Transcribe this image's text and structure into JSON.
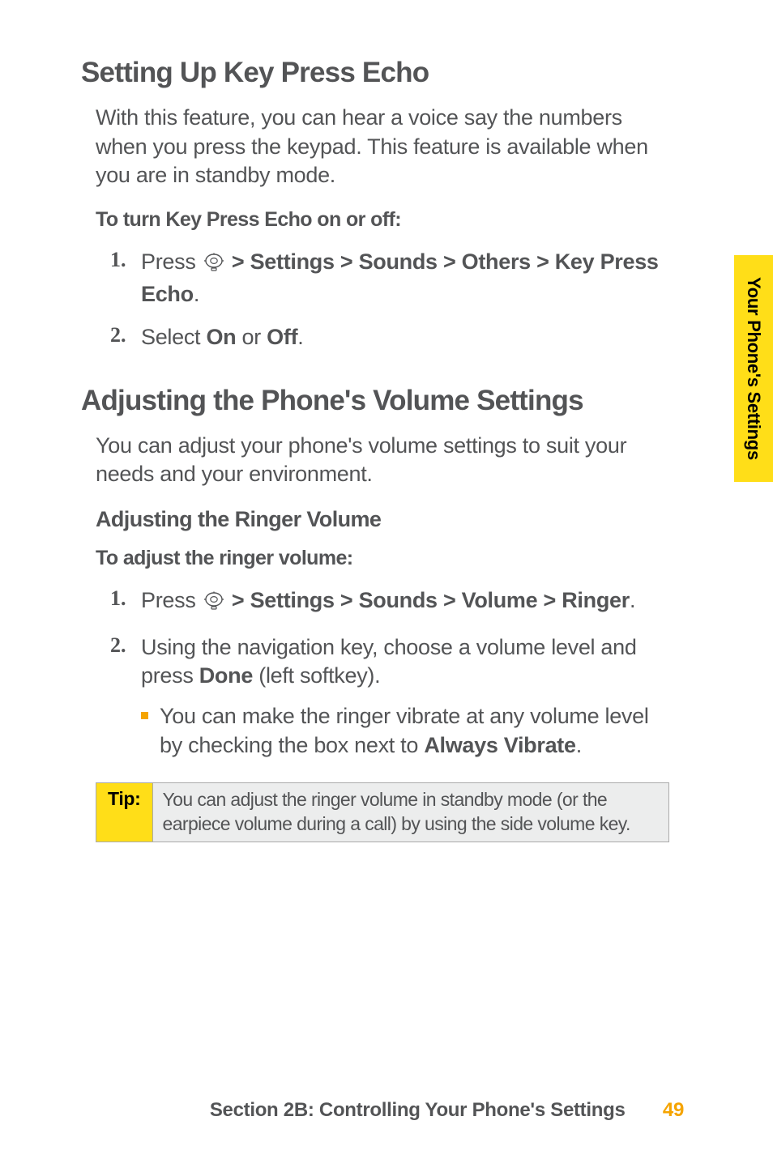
{
  "side_tab": {
    "label": "Your Phone's Settings"
  },
  "section1": {
    "heading": "Setting Up Key Press Echo",
    "intro": "With this feature, you can hear a voice say the numbers when you press the keypad. This feature is available when you are in standby mode.",
    "lead_in": "To turn Key Press Echo on or off:",
    "steps": [
      {
        "num": "1.",
        "prefix": "Press ",
        "path": "> Settings > Sounds > Others > Key Press Echo",
        "suffix": "."
      },
      {
        "num": "2.",
        "prefix": "Select ",
        "opt1": "On",
        "mid": " or ",
        "opt2": "Off",
        "suffix": "."
      }
    ]
  },
  "section2": {
    "heading": "Adjusting the Phone's Volume Settings",
    "intro": "You can adjust your phone's volume settings to suit your needs and your environment.",
    "subheading": "Adjusting the Ringer Volume",
    "lead_in": "To adjust the ringer volume:",
    "steps": [
      {
        "num": "1.",
        "prefix": "Press ",
        "path": "> Settings > Sounds > Volume > Ringer",
        "suffix": "."
      },
      {
        "num": "2.",
        "text_a": "Using the navigation key, choose a volume level and press ",
        "bold_a": "Done",
        "text_b": " (left softkey)."
      }
    ],
    "sub_bullet": {
      "text_a": "You can make the ringer vibrate at any volume level by checking the box next to ",
      "bold_a": "Always Vibrate",
      "text_b": "."
    }
  },
  "tip": {
    "label": "Tip:",
    "body": "You can adjust the ringer volume in standby mode (or the earpiece volume during a call) by using the side volume key."
  },
  "footer": {
    "text": "Section 2B: Controlling Your Phone's Settings",
    "page": "49"
  }
}
